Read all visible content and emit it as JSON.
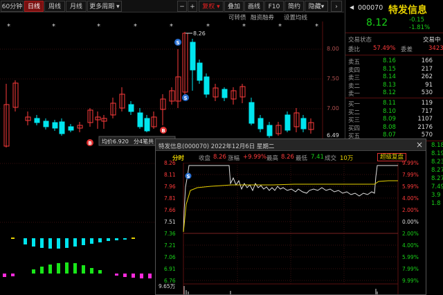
{
  "toolbar": {
    "period_label": "60分钟",
    "buttons": [
      "日线",
      "周线",
      "月线",
      "更多周期"
    ],
    "nav_minus": "−",
    "nav_plus": "+",
    "fq_label": "复权",
    "items": [
      "叠加",
      "画线",
      "F10",
      "简约",
      "隐藏"
    ]
  },
  "subtoolbar": {
    "items": [
      "可转债",
      "融资融券",
      "设置均线"
    ]
  },
  "kline": {
    "price_axis": [
      "8.00",
      "7.50",
      "7.00",
      "6.49"
    ],
    "high_label": "8.26",
    "avg_tip": "均价6.920",
    "share_tip": "分4笔共",
    "markers": [
      "S",
      "S",
      "B",
      "B"
    ],
    "star": "*"
  },
  "quote": {
    "code": "000070",
    "name": "特发信息",
    "price": "8.12",
    "change": "-0.15",
    "change_pct": "-1.81%",
    "status_label": "交易状态",
    "status_value": "交易中",
    "ratio_label": "委比",
    "ratio_value": "57.49%",
    "diff_label": "委差",
    "diff_value": "3423",
    "sells": [
      {
        "label": "卖五",
        "price": "8.16",
        "vol": "166"
      },
      {
        "label": "卖四",
        "price": "8.15",
        "vol": "217"
      },
      {
        "label": "卖三",
        "price": "8.14",
        "vol": "262"
      },
      {
        "label": "卖二",
        "price": "8.13",
        "vol": "91"
      },
      {
        "label": "卖一",
        "price": "8.12",
        "vol": "530"
      }
    ],
    "buys": [
      {
        "label": "买一",
        "price": "8.11",
        "vol": "119"
      },
      {
        "label": "买二",
        "price": "8.10",
        "vol": "717"
      },
      {
        "label": "买三",
        "price": "8.09",
        "vol": "1107"
      },
      {
        "label": "买四",
        "price": "8.08",
        "vol": "2176"
      },
      {
        "label": "买五",
        "price": "8.07",
        "vol": "570"
      }
    ],
    "side_values": [
      "8.18",
      "8.19",
      "8.23",
      "8.27",
      "8.27",
      "7.49",
      "3.9",
      "1.8"
    ]
  },
  "intraday": {
    "header_title": "特发信息(000070) 2022年12月6日 星期二",
    "close_btn": "×",
    "info": {
      "tab": "分时",
      "close_label": "收盘",
      "close_value": "8.26",
      "chg_label": "涨幅",
      "chg_value": "+9.99%",
      "high_label": "最高",
      "high_value": "8.26",
      "low_label": "最低",
      "low_value": "7.41",
      "vol_label": "成交",
      "vol_value": "10万",
      "replay_btn": "超级复盘"
    },
    "price_ticks": [
      "8.26",
      "8.11",
      "7.96",
      "7.81",
      "7.66",
      "7.51",
      "7.36",
      "7.21",
      "7.06",
      "6.91",
      "6.76"
    ],
    "pct_ticks": [
      "9.99%",
      "7.99%",
      "5.99%",
      "4.00%",
      "2.00%",
      "0.00%",
      "2.00%",
      "4.00%",
      "5.99%",
      "7.99%",
      "9.99%"
    ],
    "vol_tick": "9.65万",
    "s_marker": "S"
  }
}
